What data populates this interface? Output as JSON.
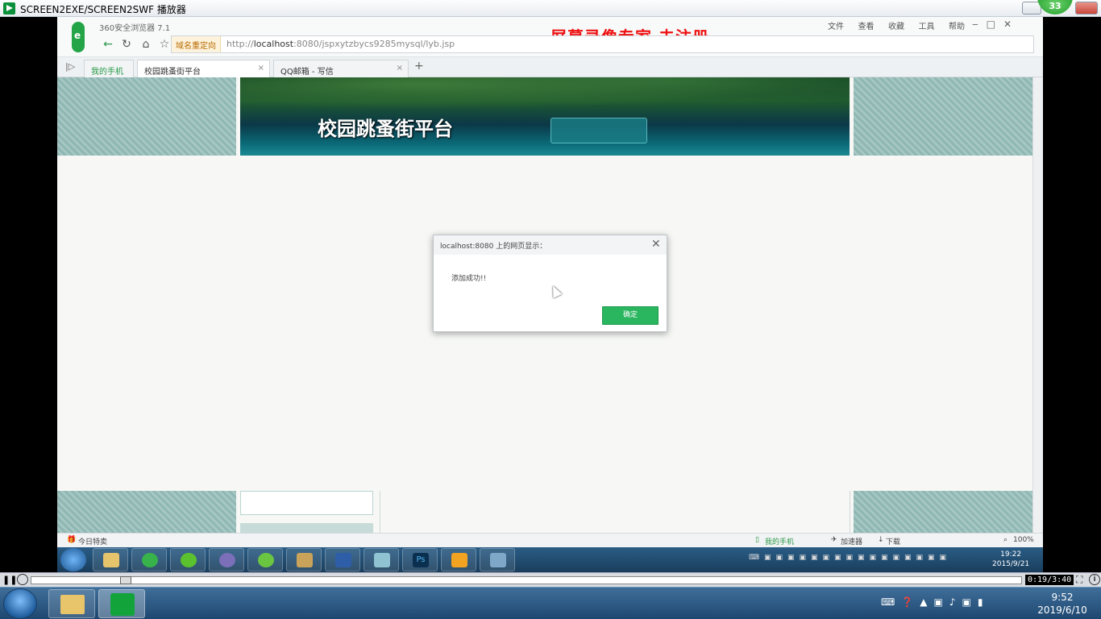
{
  "player": {
    "title": "SCREEN2EXE/SCREEN2SWF 播放器",
    "badge": "33",
    "time": "0:19/3:40"
  },
  "browser": {
    "name": "360安全浏览器 7.1",
    "watermark": "屏幕录像专家 未注册",
    "menu": [
      "文件",
      "查看",
      "收藏",
      "工具",
      "帮助"
    ],
    "redirect_label": "域名重定向",
    "url_prefix": "http://",
    "url_host": "localhost",
    "url_rest": ":8080/jspxytzbycs9285mysql/lyb.jsp",
    "tabs": [
      {
        "label": "我的手机"
      },
      {
        "label": "校园跳蚤街平台"
      },
      {
        "label": "QQ邮箱 - 写信"
      }
    ]
  },
  "page": {
    "banner_title": "校园跳蚤街平台"
  },
  "dialog": {
    "title": "localhost:8080 上的网页显示：",
    "message": "添加成功!!",
    "ok_label": "确定"
  },
  "statusbar": {
    "left": "今日特卖",
    "phone": "我的手机",
    "accelerator": "加速器",
    "download": "下载",
    "zoom": "100%"
  },
  "inner_clock": {
    "time": "19:22",
    "date": "2015/9/21"
  },
  "taskbar_clock": {
    "time": "9:52",
    "date": "2019/6/10"
  },
  "colors": {
    "accent_green": "#2ab55f",
    "watermark_red": "#ee1111"
  }
}
